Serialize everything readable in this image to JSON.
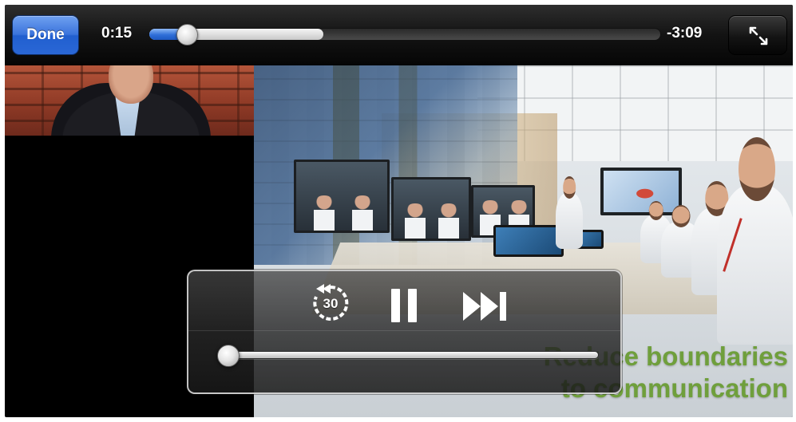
{
  "top_bar": {
    "done_label": "Done",
    "elapsed_time": "0:15",
    "remaining_time": "-3:09",
    "playback_progress": 0.075,
    "buffered_progress": 0.34
  },
  "controls": {
    "rewind_label": "30",
    "volume_level": 0.0
  },
  "video": {
    "headline_line1": "Reduce boundaries",
    "headline_line2": "to communication"
  },
  "colors": {
    "done_button": "#3b74dc",
    "progress_fill": "#2f6fd8",
    "headline_text": "#6f9f3c"
  },
  "icons": [
    "rewind-30-icon",
    "pause-icon",
    "next-track-icon",
    "fullscreen-toggle-icon"
  ]
}
